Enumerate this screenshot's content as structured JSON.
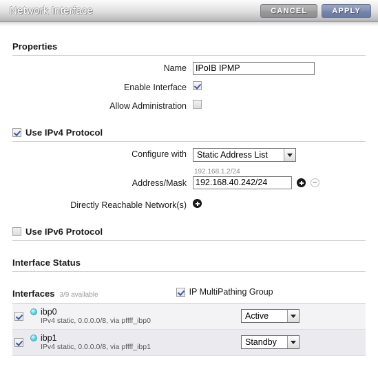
{
  "titlebar": {
    "title": "Network Interface",
    "cancel_label": "CANCEL",
    "apply_label": "APPLY"
  },
  "properties": {
    "heading": "Properties",
    "name_label": "Name",
    "name_value": "IPoIB IPMP",
    "name_placeholder": "",
    "enable_interface_label": "Enable Interface",
    "enable_interface_checked": "checked",
    "allow_admin_label": "Allow Administration",
    "allow_admin_checked": "unchecked"
  },
  "ipv4": {
    "heading": "Use IPv4 Protocol",
    "checked": "checked",
    "configure_label": "Configure with",
    "configure_value": "Static Address List",
    "address_label": "Address/Mask",
    "address_hint": "192.168.1.2/24",
    "address_value": "192.168.40.242/24",
    "add_icon": "plus-circle-icon",
    "remove_icon": "minus-circle-icon",
    "reachable_label": "Directly Reachable Network(s)",
    "reachable_add_icon": "plus-circle-icon"
  },
  "ipv6": {
    "heading": "Use IPv6 Protocol",
    "checked": "unchecked"
  },
  "interface_status": {
    "heading": "Interface Status",
    "interfaces_label": "Interfaces",
    "available_count": "3/9 available",
    "ipmp_label": "IP MultiPathing Group",
    "ipmp_checked": "checked",
    "rows": [
      {
        "checked": "checked",
        "status_icon": "status-dot-icon",
        "name": "ibp0",
        "detail": "IPv4 static, 0.0.0.0/8, via pffff_ibp0",
        "role": "Active"
      },
      {
        "checked": "checked",
        "status_icon": "status-dot-icon",
        "name": "ibp1",
        "detail": "IPv4 static, 0.0.0.0/8, via pffff_ibp1",
        "role": "Standby"
      }
    ]
  },
  "colors": {
    "accent_apply": "#7786ac",
    "status_dot": "#2fadc4",
    "checkmark": "#3a5aa8",
    "rule": "#d0d0d0"
  }
}
